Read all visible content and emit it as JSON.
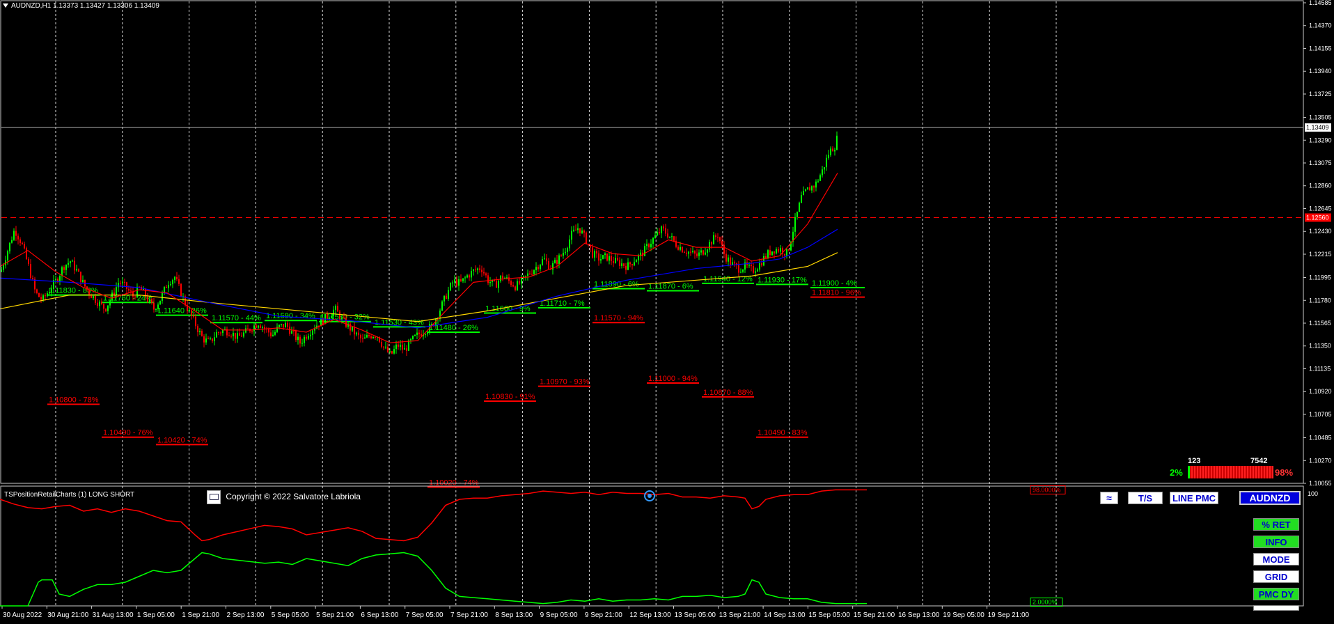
{
  "chart_header": "AUDNZD,H1  1.13373 1.13427 1.13306 1.13409",
  "indicator_header": "TSPositionRetailCharts (1) LONG SHORT",
  "copyright": "Copyright © 2022 Salvatore Labriola",
  "sub_top_value": "100",
  "sub_red_value": "98.0000%",
  "sub_green_value": "2.0000%",
  "stats": {
    "count_left": "123",
    "count_right": "7542",
    "pct_left": "2%",
    "pct_right": "98%"
  },
  "buttons": {
    "wave": "",
    "ts": "T/S",
    "line_pmc": "LINE PMC",
    "symbol": "AUDNZD",
    "ret": "% RET",
    "info": "INFO",
    "mode": "MODE",
    "grid": "GRID",
    "pmc_dy": "PMC DY"
  },
  "colors": {
    "bull": "#00ff00",
    "bear": "#ff0000",
    "ma_fast": "#ff0000",
    "ma_mid": "#0000ff",
    "ma_slow": "#ffd700",
    "grid": "#ffffff",
    "price_line": "#aaaaaa"
  },
  "chart_data": {
    "type": "line",
    "symbol": "AUDNZD",
    "timeframe": "H1",
    "ohlc_last": {
      "open": 1.13373,
      "high": 1.13427,
      "low": 1.13306,
      "close": 1.13409
    },
    "ylim": [
      1.10055,
      1.14585
    ],
    "y_ticks": [
      1.14585,
      1.1437,
      1.14155,
      1.1394,
      1.13725,
      1.13505,
      1.1329,
      1.13075,
      1.1286,
      1.12645,
      1.1243,
      1.12215,
      1.11995,
      1.1178,
      1.11565,
      1.1135,
      1.11135,
      1.1092,
      1.10705,
      1.10485,
      1.1027,
      1.10055
    ],
    "y_tick_labels": [
      "1.14585",
      "1.14370",
      "1.14155",
      "1.13940",
      "1.13725",
      "1.13505",
      "1.13290",
      "1.13075",
      "1.12860",
      "1.12645",
      "1.12430",
      "1.12215",
      "1.11995",
      "1.11780",
      "1.11565",
      "1.11350",
      "1.11135",
      "1.10920",
      "1.10705",
      "1.10485",
      "1.10270",
      "1.10055"
    ],
    "current_price": "1.13409",
    "red_level": "1.12560",
    "x_labels": [
      "30 Aug 2022",
      "30 Aug 21:00",
      "31 Aug 13:00",
      "1 Sep 05:00",
      "1 Sep 21:00",
      "2 Sep 13:00",
      "5 Sep 05:00",
      "5 Sep 21:00",
      "6 Sep 13:00",
      "7 Sep 05:00",
      "7 Sep 21:00",
      "8 Sep 13:00",
      "9 Sep 05:00",
      "9 Sep 21:00",
      "12 Sep 13:00",
      "13 Sep 05:00",
      "13 Sep 21:00",
      "14 Sep 13:00",
      "15 Sep 05:00",
      "15 Sep 21:00",
      "16 Sep 13:00",
      "19 Sep 05:00",
      "19 Sep 21:00"
    ],
    "close_path": [
      [
        0,
        1.1205
      ],
      [
        10,
        1.1225
      ],
      [
        20,
        1.1245
      ],
      [
        30,
        1.1232
      ],
      [
        40,
        1.121
      ],
      [
        50,
        1.1185
      ],
      [
        60,
        1.1178
      ],
      [
        70,
        1.1188
      ],
      [
        80,
        1.1197
      ],
      [
        90,
        1.121
      ],
      [
        100,
        1.1215
      ],
      [
        110,
        1.1205
      ],
      [
        120,
        1.1192
      ],
      [
        130,
        1.1183
      ],
      [
        140,
        1.1176
      ],
      [
        150,
        1.117
      ],
      [
        160,
        1.1182
      ],
      [
        170,
        1.1196
      ],
      [
        180,
        1.119
      ],
      [
        190,
        1.1182
      ],
      [
        200,
        1.119
      ],
      [
        210,
        1.118
      ],
      [
        220,
        1.117
      ],
      [
        230,
        1.118
      ],
      [
        240,
        1.1195
      ],
      [
        250,
        1.12
      ],
      [
        260,
        1.1183
      ],
      [
        270,
        1.1168
      ],
      [
        280,
        1.1155
      ],
      [
        290,
        1.1142
      ],
      [
        300,
        1.1138
      ],
      [
        310,
        1.1147
      ],
      [
        320,
        1.115
      ],
      [
        330,
        1.1148
      ],
      [
        340,
        1.1143
      ],
      [
        350,
        1.1147
      ],
      [
        360,
        1.1152
      ],
      [
        370,
        1.1157
      ],
      [
        380,
        1.1151
      ],
      [
        390,
        1.1145
      ],
      [
        400,
        1.1153
      ],
      [
        410,
        1.1155
      ],
      [
        420,
        1.1146
      ],
      [
        430,
        1.1138
      ],
      [
        440,
        1.1146
      ],
      [
        450,
        1.1153
      ],
      [
        460,
        1.1158
      ],
      [
        470,
        1.1163
      ],
      [
        480,
        1.117
      ],
      [
        490,
        1.116
      ],
      [
        500,
        1.1153
      ],
      [
        510,
        1.1146
      ],
      [
        520,
        1.114
      ],
      [
        530,
        1.1145
      ],
      [
        540,
        1.1146
      ],
      [
        550,
        1.1134
      ],
      [
        560,
        1.1126
      ],
      [
        570,
        1.1136
      ],
      [
        580,
        1.1131
      ],
      [
        590,
        1.114
      ],
      [
        600,
        1.1146
      ],
      [
        610,
        1.115
      ],
      [
        620,
        1.1154
      ],
      [
        630,
        1.1168
      ],
      [
        640,
        1.1183
      ],
      [
        650,
        1.1196
      ],
      [
        660,
        1.1194
      ],
      [
        670,
        1.1201
      ],
      [
        680,
        1.1206
      ],
      [
        690,
        1.1209
      ],
      [
        700,
        1.1197
      ],
      [
        710,
        1.1192
      ],
      [
        720,
        1.1201
      ],
      [
        730,
        1.1196
      ],
      [
        740,
        1.1191
      ],
      [
        750,
        1.1197
      ],
      [
        760,
        1.1204
      ],
      [
        770,
        1.121
      ],
      [
        780,
        1.1217
      ],
      [
        790,
        1.1209
      ],
      [
        800,
        1.1216
      ],
      [
        810,
        1.1225
      ],
      [
        820,
        1.124
      ],
      [
        830,
        1.1247
      ],
      [
        840,
        1.1236
      ],
      [
        850,
        1.1222
      ],
      [
        860,
        1.1217
      ],
      [
        870,
        1.1219
      ],
      [
        880,
        1.1215
      ],
      [
        890,
        1.1213
      ],
      [
        900,
        1.121
      ],
      [
        910,
        1.1216
      ],
      [
        920,
        1.1221
      ],
      [
        930,
        1.123
      ],
      [
        940,
        1.1238
      ],
      [
        950,
        1.1245
      ],
      [
        960,
        1.1239
      ],
      [
        970,
        1.1231
      ],
      [
        980,
        1.1226
      ],
      [
        990,
        1.1223
      ],
      [
        1000,
        1.122
      ],
      [
        1010,
        1.1225
      ],
      [
        1020,
        1.1233
      ],
      [
        1030,
        1.124
      ],
      [
        1040,
        1.122
      ],
      [
        1050,
        1.1212
      ],
      [
        1060,
        1.1208
      ],
      [
        1070,
        1.121
      ],
      [
        1080,
        1.1206
      ],
      [
        1090,
        1.1212
      ],
      [
        1100,
        1.1221
      ],
      [
        1110,
        1.1226
      ],
      [
        1120,
        1.1226
      ],
      [
        1130,
        1.1222
      ],
      [
        1140,
        1.125
      ],
      [
        1150,
        1.1275
      ],
      [
        1160,
        1.1283
      ],
      [
        1170,
        1.1287
      ],
      [
        1180,
        1.13
      ],
      [
        1190,
        1.1318
      ],
      [
        1200,
        1.1325
      ],
      [
        1203,
        1.1341
      ]
    ],
    "ma_fast": [
      [
        0,
        1.121
      ],
      [
        40,
        1.1225
      ],
      [
        80,
        1.1205
      ],
      [
        120,
        1.119
      ],
      [
        160,
        1.118
      ],
      [
        200,
        1.1188
      ],
      [
        240,
        1.1185
      ],
      [
        280,
        1.1168
      ],
      [
        320,
        1.115
      ],
      [
        360,
        1.115
      ],
      [
        400,
        1.1152
      ],
      [
        440,
        1.1148
      ],
      [
        480,
        1.116
      ],
      [
        520,
        1.115
      ],
      [
        560,
        1.1138
      ],
      [
        600,
        1.114
      ],
      [
        640,
        1.1168
      ],
      [
        680,
        1.1195
      ],
      [
        720,
        1.1198
      ],
      [
        760,
        1.12
      ],
      [
        800,
        1.121
      ],
      [
        840,
        1.1232
      ],
      [
        880,
        1.1222
      ],
      [
        920,
        1.122
      ],
      [
        960,
        1.1235
      ],
      [
        1000,
        1.1228
      ],
      [
        1040,
        1.1228
      ],
      [
        1080,
        1.1215
      ],
      [
        1120,
        1.122
      ],
      [
        1160,
        1.125
      ],
      [
        1203,
        1.1298
      ]
    ],
    "ma_mid": [
      [
        0,
        1.1199
      ],
      [
        100,
        1.1195
      ],
      [
        200,
        1.119
      ],
      [
        300,
        1.1176
      ],
      [
        400,
        1.1163
      ],
      [
        500,
        1.1159
      ],
      [
        600,
        1.1152
      ],
      [
        700,
        1.1162
      ],
      [
        800,
        1.1182
      ],
      [
        900,
        1.1197
      ],
      [
        1000,
        1.1208
      ],
      [
        1080,
        1.1213
      ],
      [
        1120,
        1.1217
      ],
      [
        1160,
        1.1228
      ],
      [
        1203,
        1.1245
      ]
    ],
    "ma_slow": [
      [
        0,
        1.117
      ],
      [
        100,
        1.1183
      ],
      [
        200,
        1.1183
      ],
      [
        300,
        1.1176
      ],
      [
        400,
        1.117
      ],
      [
        500,
        1.1164
      ],
      [
        600,
        1.1158
      ],
      [
        700,
        1.1168
      ],
      [
        800,
        1.118
      ],
      [
        900,
        1.1192
      ],
      [
        1000,
        1.1197
      ],
      [
        1080,
        1.1201
      ],
      [
        1160,
        1.121
      ],
      [
        1203,
        1.1223
      ]
    ]
  },
  "levels_green": [
    {
      "label": "1.11830 - 83%",
      "price": 1.1183,
      "x1": 68,
      "x2": 143
    },
    {
      "label": "1.11760 - 24%",
      "price": 1.1176,
      "x1": 146,
      "x2": 221
    },
    {
      "label": "1.11640 - 26%",
      "price": 1.1164,
      "x1": 224,
      "x2": 299
    },
    {
      "label": "1.11570 - 44%",
      "price": 1.1157,
      "x1": 302,
      "x2": 377
    },
    {
      "label": "1.11590 - 34%",
      "price": 1.1159,
      "x1": 380,
      "x2": 455
    },
    {
      "label": "1.11580 - 32%",
      "price": 1.1158,
      "x1": 458,
      "x2": 533
    },
    {
      "label": "1.11530 - 43%",
      "price": 1.1153,
      "x1": 536,
      "x2": 611
    },
    {
      "label": "1.11480 - 26%",
      "price": 1.1148,
      "x1": 614,
      "x2": 689
    },
    {
      "label": "1.11660 - 9%",
      "price": 1.1166,
      "x1": 695,
      "x2": 770
    },
    {
      "label": "1.11710 - 7%",
      "price": 1.1171,
      "x1": 773,
      "x2": 848
    },
    {
      "label": "1.11890 - 6%",
      "price": 1.1189,
      "x1": 851,
      "x2": 926
    },
    {
      "label": "1.11870 - 6%",
      "price": 1.1187,
      "x1": 929,
      "x2": 1004
    },
    {
      "label": "1.11940 - 12%",
      "price": 1.1194,
      "x1": 1008,
      "x2": 1083
    },
    {
      "label": "1.11930 - 17%",
      "price": 1.1193,
      "x1": 1086,
      "x2": 1161
    },
    {
      "label": "1.11900 - 4%",
      "price": 1.119,
      "x1": 1164,
      "x2": 1242
    }
  ],
  "levels_red": [
    {
      "label": "1.10800 - 78%",
      "price": 1.108,
      "x1": 68,
      "x2": 143
    },
    {
      "label": "1.10490 - 76%",
      "price": 1.1049,
      "x1": 146,
      "x2": 221
    },
    {
      "label": "1.10420 - 74%",
      "price": 1.1042,
      "x1": 224,
      "x2": 299
    },
    {
      "label": "1.10020 - 74%",
      "price": 1.1002,
      "x1": 614,
      "x2": 689
    },
    {
      "label": "1.10830 - 91%",
      "price": 1.1083,
      "x1": 695,
      "x2": 770
    },
    {
      "label": "1.10970 - 93%",
      "price": 1.1097,
      "x1": 773,
      "x2": 848
    },
    {
      "label": "1.11570 - 94%",
      "price": 1.1157,
      "x1": 851,
      "x2": 926
    },
    {
      "label": "1.11000 - 94%",
      "price": 1.11,
      "x1": 929,
      "x2": 1004
    },
    {
      "label": "1.10870 - 88%",
      "price": 1.1087,
      "x1": 1008,
      "x2": 1083
    },
    {
      "label": "1.10490 - 83%",
      "price": 1.1049,
      "x1": 1086,
      "x2": 1161
    },
    {
      "label": "1.11810 - 96%",
      "price": 1.1181,
      "x1": 1164,
      "x2": 1242
    }
  ],
  "sub_red_line": [
    [
      0,
      90
    ],
    [
      20,
      86
    ],
    [
      40,
      83
    ],
    [
      60,
      82
    ],
    [
      80,
      84
    ],
    [
      100,
      85
    ],
    [
      120,
      80
    ],
    [
      140,
      82
    ],
    [
      160,
      79
    ],
    [
      180,
      82
    ],
    [
      200,
      80
    ],
    [
      220,
      76
    ],
    [
      240,
      72
    ],
    [
      260,
      71
    ],
    [
      280,
      60
    ],
    [
      290,
      55
    ],
    [
      300,
      56
    ],
    [
      320,
      60
    ],
    [
      350,
      64
    ],
    [
      380,
      68
    ],
    [
      400,
      67
    ],
    [
      420,
      65
    ],
    [
      440,
      60
    ],
    [
      460,
      62
    ],
    [
      480,
      64
    ],
    [
      500,
      66
    ],
    [
      520,
      63
    ],
    [
      540,
      57
    ],
    [
      560,
      56
    ],
    [
      580,
      55
    ],
    [
      600,
      58
    ],
    [
      620,
      70
    ],
    [
      640,
      85
    ],
    [
      660,
      90
    ],
    [
      680,
      91
    ],
    [
      700,
      91
    ],
    [
      720,
      93
    ],
    [
      740,
      94
    ],
    [
      760,
      95
    ],
    [
      780,
      97
    ],
    [
      800,
      96
    ],
    [
      820,
      95
    ],
    [
      840,
      96
    ],
    [
      860,
      94
    ],
    [
      880,
      96
    ],
    [
      900,
      95
    ],
    [
      920,
      95
    ],
    [
      940,
      94
    ],
    [
      960,
      95
    ],
    [
      980,
      92
    ],
    [
      1000,
      92
    ],
    [
      1020,
      91
    ],
    [
      1040,
      93
    ],
    [
      1060,
      92
    ],
    [
      1070,
      91
    ],
    [
      1080,
      82
    ],
    [
      1090,
      84
    ],
    [
      1100,
      90
    ],
    [
      1120,
      93
    ],
    [
      1140,
      94
    ],
    [
      1160,
      94
    ],
    [
      1180,
      97
    ],
    [
      1200,
      98
    ],
    [
      1245,
      98
    ]
  ],
  "sub_green_line": [
    [
      0,
      0
    ],
    [
      20,
      0
    ],
    [
      40,
      0
    ],
    [
      55,
      20
    ],
    [
      60,
      22
    ],
    [
      75,
      22
    ],
    [
      85,
      10
    ],
    [
      100,
      8
    ],
    [
      120,
      14
    ],
    [
      140,
      18
    ],
    [
      160,
      18
    ],
    [
      180,
      20
    ],
    [
      200,
      25
    ],
    [
      220,
      30
    ],
    [
      240,
      28
    ],
    [
      260,
      30
    ],
    [
      280,
      40
    ],
    [
      290,
      45
    ],
    [
      300,
      44
    ],
    [
      320,
      40
    ],
    [
      350,
      38
    ],
    [
      380,
      36
    ],
    [
      400,
      37
    ],
    [
      420,
      35
    ],
    [
      440,
      40
    ],
    [
      460,
      38
    ],
    [
      480,
      36
    ],
    [
      500,
      34
    ],
    [
      520,
      40
    ],
    [
      540,
      43
    ],
    [
      560,
      44
    ],
    [
      580,
      45
    ],
    [
      600,
      42
    ],
    [
      620,
      30
    ],
    [
      640,
      15
    ],
    [
      660,
      8
    ],
    [
      680,
      7
    ],
    [
      700,
      6
    ],
    [
      720,
      5
    ],
    [
      740,
      4
    ],
    [
      760,
      3
    ],
    [
      780,
      2
    ],
    [
      800,
      3
    ],
    [
      820,
      5
    ],
    [
      840,
      4
    ],
    [
      860,
      6
    ],
    [
      880,
      4
    ],
    [
      900,
      5
    ],
    [
      920,
      5
    ],
    [
      940,
      6
    ],
    [
      960,
      5
    ],
    [
      980,
      8
    ],
    [
      1000,
      8
    ],
    [
      1020,
      9
    ],
    [
      1040,
      7
    ],
    [
      1060,
      8
    ],
    [
      1070,
      10
    ],
    [
      1080,
      22
    ],
    [
      1090,
      20
    ],
    [
      1100,
      10
    ],
    [
      1120,
      7
    ],
    [
      1140,
      6
    ],
    [
      1160,
      6
    ],
    [
      1180,
      3
    ],
    [
      1200,
      2
    ],
    [
      1245,
      2
    ]
  ]
}
